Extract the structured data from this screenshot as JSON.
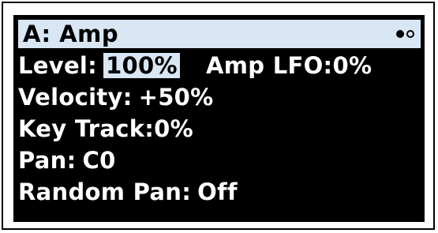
{
  "header": {
    "title": "A: Amp",
    "page_indicator": {
      "total": 2,
      "current": 1
    }
  },
  "params": {
    "level": {
      "label": "Level:",
      "value": "100%"
    },
    "amp_lfo": {
      "label": "Amp LFO:",
      "value": "0%"
    },
    "velocity": {
      "label": "Velocity:",
      "value": "+50%"
    },
    "key_track": {
      "label": "Key Track:",
      "value": "0%"
    },
    "pan": {
      "label": "Pan:",
      "value": "C0"
    },
    "random_pan": {
      "label": "Random Pan:",
      "value": "Off"
    }
  },
  "colors": {
    "screen_background": "#000000",
    "highlight": "#d9e6f3",
    "text": "#ffffff"
  }
}
